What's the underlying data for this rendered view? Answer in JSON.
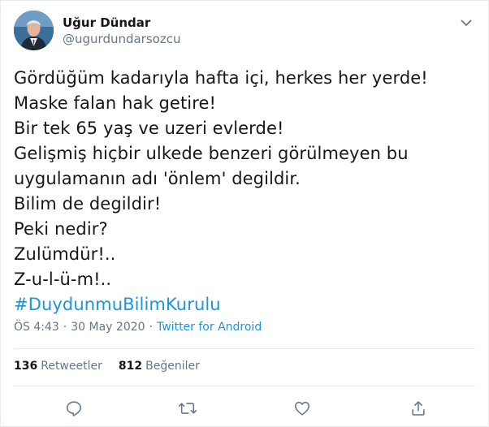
{
  "author": {
    "display_name": "Uğur Dündar",
    "handle": "@ugurdundarsozcu"
  },
  "tweet": {
    "lines": [
      "Gördüğüm kadarıyla hafta içi, herkes her yerde!",
      "Maske falan hak getire!",
      "Bir tek 65 yaş ve uzeri evlerde!",
      "Gelişmiş hiçbir ulkede benzeri görülmeyen bu",
      "uygulamanın adı 'önlem' degildir.",
      "Bilim de degildir!",
      "Peki nedir?",
      "Zulümdür!..",
      "Z-u-l-ü-m!.."
    ],
    "hashtag": "#DuydunmuBilimKurulu"
  },
  "meta": {
    "time": "ÖS 4:43",
    "separator": "·",
    "date": "30 May 2020",
    "source": "Twitter for Android"
  },
  "stats": {
    "retweets_count": "136",
    "retweets_label": "Retweetler",
    "likes_count": "812",
    "likes_label": "Beğeniler"
  },
  "actions": [
    "reply-icon",
    "retweet-icon",
    "like-icon",
    "share-icon"
  ],
  "colors": {
    "text": "#14171a",
    "secondary": "#657786",
    "link": "#1b95e0",
    "border": "#e6ecf0"
  }
}
